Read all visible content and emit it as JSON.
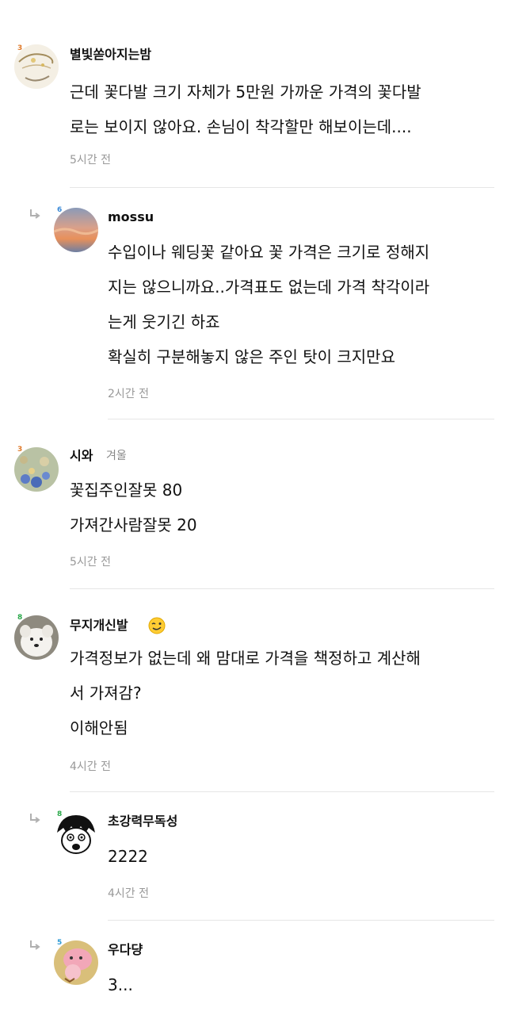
{
  "comments": [
    {
      "author": "별빛쏟아지는밤",
      "level": "3",
      "lines": [
        "근데 꽃다발 크기 자체가 5만원 가까운 가격의 꽃다발",
        "로는 보이지 않아요. 손님이 착각할만 해보이는데...."
      ],
      "time": "5시간 전",
      "avatar": "sparkle-sketch-avatar"
    },
    {
      "author": "mossu",
      "level": "6",
      "lines": [
        "수입이나 웨딩꽃 같아요 꽃 가격은 크기로 정해지",
        "지는 않으니까요..가격표도 없는데 가격 착각이라",
        "는게 웃기긴 하죠",
        "확실히 구분해놓지 않은 주인 탓이 크지만요"
      ],
      "time": "2시간 전",
      "reply": true,
      "avatar": "sunset-sky-avatar"
    },
    {
      "author": "시와",
      "tag": "겨울",
      "level": "3",
      "lines": [
        "꽃집주인잘못 80",
        "가져간사람잘못 20"
      ],
      "time": "5시간 전",
      "avatar": "flower-field-avatar"
    },
    {
      "author": "무지개신발",
      "level": "8",
      "lines": [
        "가격정보가 없는데 왜 맘대로 가격을 책정하고 계산해",
        "서 가져감?",
        "이해안됨"
      ],
      "time": "4시간 전",
      "badge": "winking-face-emoji",
      "avatar": "white-dog-avatar"
    },
    {
      "author": "초강력무독성",
      "level": "8",
      "lines": [
        "2222"
      ],
      "time": "4시간 전",
      "reply": true,
      "avatar": "cartoon-face-avatar"
    },
    {
      "author": "우다댱",
      "level": "5",
      "lines": [
        "3..."
      ],
      "time": "",
      "reply": true,
      "avatar": "pink-cartoon-avatar"
    }
  ],
  "colors": {
    "level_3": "#e07a2a",
    "level_6": "#3a8ad8",
    "level_5": "#2d9bd6",
    "level_8": "#2aa84a",
    "divider": "#e6e6e6",
    "meta": "#999999"
  }
}
